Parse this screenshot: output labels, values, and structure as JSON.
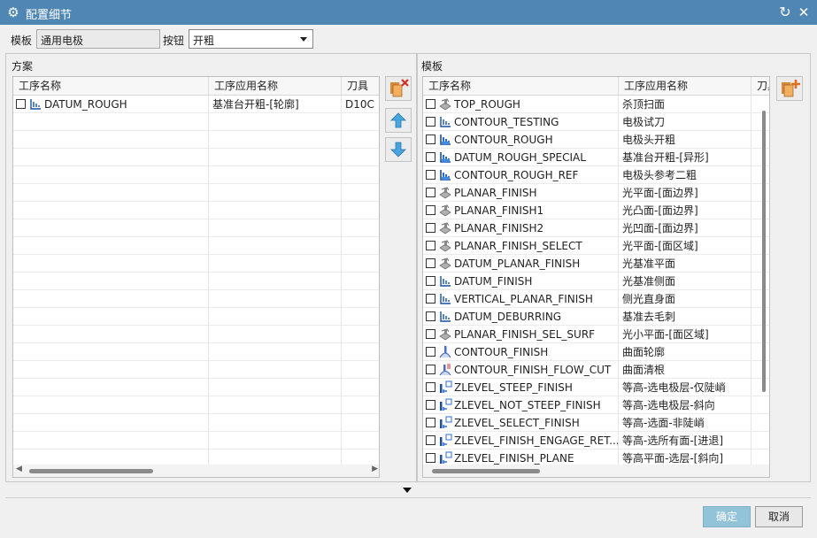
{
  "window": {
    "title": "配置细节",
    "gear_icon": "gear-icon",
    "reset_icon": "reset-icon",
    "close_icon": "close-icon",
    "title_bg": "#4f86b3"
  },
  "template_row": {
    "label": "模板",
    "value": "通用电极",
    "button_label": "按钮",
    "button_value": "开粗"
  },
  "scheme": {
    "label": "方案",
    "columns": [
      "工序名称",
      "工序应用名称",
      "刀具"
    ],
    "rows": [
      {
        "checked": false,
        "name": "DATUM_ROUGH",
        "app": "基准台开粗-[轮廓]",
        "tool": "D10C",
        "icon": "cavity-mill-icon"
      }
    ]
  },
  "middle_buttons": {
    "delete": "delete-icon",
    "up": "arrow-up-icon",
    "down": "arrow-down-icon"
  },
  "templates": {
    "label": "模板",
    "columns": [
      "工序名称",
      "工序应用名称",
      "刀具"
    ],
    "rows": [
      {
        "name": "TOP_ROUGH",
        "app": "杀顶扫面",
        "icon": "face-mill-icon"
      },
      {
        "name": "CONTOUR_TESTING",
        "app": "电极试刀",
        "icon": "cavity-mill-icon"
      },
      {
        "name": "CONTOUR_ROUGH",
        "app": "电极头开粗",
        "icon": "cavity-blue-icon"
      },
      {
        "name": "DATUM_ROUGH_SPECIAL",
        "app": "基准台开粗-[异形]",
        "icon": "cavity-blue-icon"
      },
      {
        "name": "CONTOUR_ROUGH_REF",
        "app": "电极头参考二粗",
        "icon": "cavity-blue-icon"
      },
      {
        "name": "PLANAR_FINISH",
        "app": "光平面-[面边界]",
        "icon": "face-mill-icon"
      },
      {
        "name": "PLANAR_FINISH1",
        "app": "光凸面-[面边界]",
        "icon": "face-mill-icon"
      },
      {
        "name": "PLANAR_FINISH2",
        "app": "光凹面-[面边界]",
        "icon": "face-mill-icon"
      },
      {
        "name": "PLANAR_FINISH_SELECT",
        "app": "光平面-[面区域]",
        "icon": "face-mill-icon"
      },
      {
        "name": "DATUM_PLANAR_FINISH",
        "app": "光基准平面",
        "icon": "face-mill-icon"
      },
      {
        "name": "DATUM_FINISH",
        "app": "光基准侧面",
        "icon": "cavity-mill-icon"
      },
      {
        "name": "VERTICAL_PLANAR_FINISH",
        "app": "侧光直身面",
        "icon": "cavity-mill-icon"
      },
      {
        "name": "DATUM_DEBURRING",
        "app": "基准去毛刺",
        "icon": "cavity-mill-icon"
      },
      {
        "name": "PLANAR_FINISH_SEL_SURF",
        "app": "光小平面-[面区域]",
        "icon": "face-mill-icon"
      },
      {
        "name": "CONTOUR_FINISH",
        "app": "曲面轮廓",
        "icon": "contour-icon"
      },
      {
        "name": "CONTOUR_FINISH_FLOW_CUT",
        "app": "曲面清根",
        "icon": "flowcut-icon"
      },
      {
        "name": "ZLEVEL_STEEP_FINISH",
        "app": "等高-选电极层-仅陡峭",
        "icon": "zlevel-icon"
      },
      {
        "name": "ZLEVEL_NOT_STEEP_FINISH",
        "app": "等高-选电极层-斜向",
        "icon": "zlevel-icon"
      },
      {
        "name": "ZLEVEL_SELECT_FINISH",
        "app": "等高-选面-非陡峭",
        "icon": "zlevel-icon"
      },
      {
        "name": "ZLEVEL_FINISH_ENGAGE_RET...",
        "app": "等高-选所有面-[进退]",
        "icon": "zlevel-icon"
      },
      {
        "name": "ZLEVEL_FINISH_PLANE",
        "app": "等高平面-选层-[斜向]",
        "icon": "zlevel-icon"
      }
    ]
  },
  "add_button": "add-operation-icon",
  "expand_icon": "triangle-down-icon",
  "footer": {
    "ok": "确定",
    "cancel": "取消",
    "ok_color": "#93c3d8"
  }
}
